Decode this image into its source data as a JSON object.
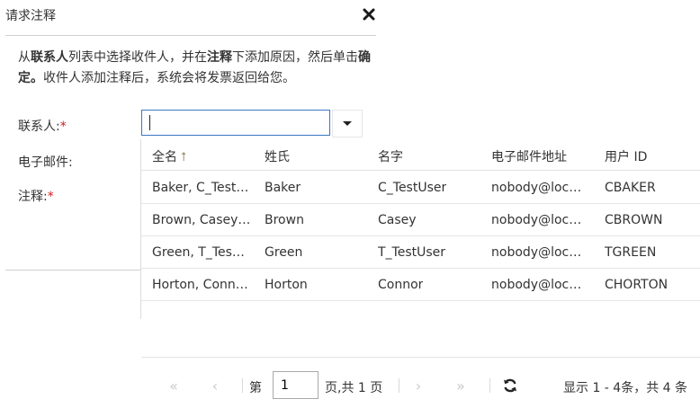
{
  "dialog": {
    "title": "请求注释",
    "instructions": {
      "p1": "从",
      "b1": "联系人",
      "p2": "列表中选择收件人，并在",
      "b2": "注释",
      "p3": "下添加原因，然后单击",
      "b3": "确定。",
      "p4": "收件人添加注释后，系统会将发票返回给您。"
    }
  },
  "form": {
    "contact_label": "联系人:",
    "email_label": "电子邮件:",
    "comment_label": "注释:",
    "required_mark": "*",
    "contact_value": ""
  },
  "grid": {
    "columns": [
      "全名",
      "姓氏",
      "名字",
      "电子邮件地址",
      "用户 ID"
    ],
    "sort_indicator": "⭡",
    "rows": [
      [
        "Baker, C_Test…",
        "Baker",
        "C_TestUser",
        "nobody@loc…",
        "CBAKER"
      ],
      [
        "Brown, Casey…",
        "Brown",
        "Casey",
        "nobody@loc…",
        "CBROWN"
      ],
      [
        "Green, T_Tes…",
        "Green",
        "T_TestUser",
        "nobody@loc…",
        "TGREEN"
      ],
      [
        "Horton, Conn…",
        "Horton",
        "Connor",
        "nobody@loc…",
        "CHORTON"
      ]
    ]
  },
  "pager": {
    "first": "«",
    "prev": "‹",
    "next": "›",
    "last": "»",
    "page_prefix": "第",
    "page_value": "1",
    "page_suffix": "页,共 1 页",
    "summary": "显示 1 - 4条，共 4 条"
  },
  "colors": {
    "accent": "#3b76c2",
    "required": "#d01c1c"
  },
  "icons": {
    "close": "close-icon",
    "dropdown": "caret-down-icon",
    "refresh": "refresh-icon"
  }
}
